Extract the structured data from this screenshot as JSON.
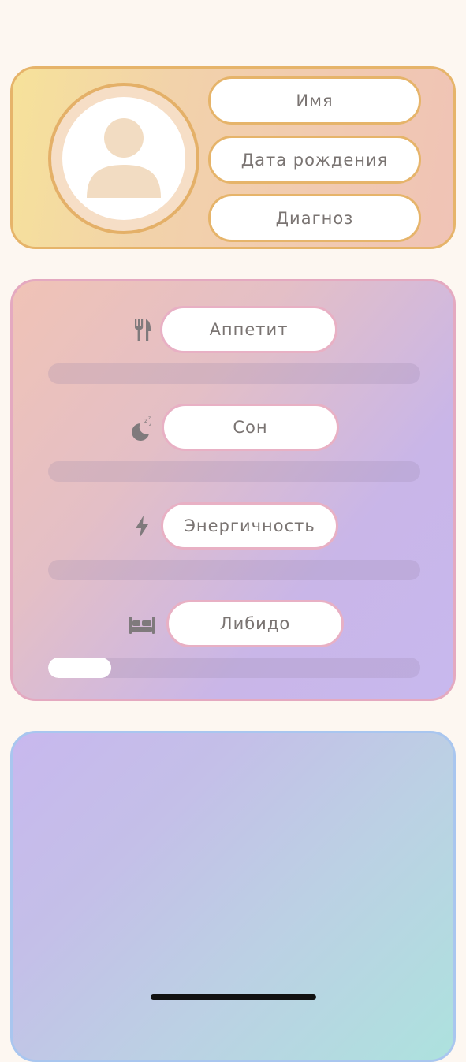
{
  "profile": {
    "name_label": "Имя",
    "birthdate_label": "Дата рождения",
    "diagnosis_label": "Диагноз"
  },
  "metrics": [
    {
      "label": "Аппетит",
      "icon": "fork-knife-icon",
      "level": 0
    },
    {
      "label": "Сон",
      "icon": "moon-sleep-icon",
      "level": 0
    },
    {
      "label": "Энергичность",
      "icon": "lightning-icon",
      "level": 0
    },
    {
      "label": "Либидо",
      "icon": "bed-icon",
      "level": 0.17
    }
  ],
  "colors": {
    "background": "#fdf7f1",
    "profile_border": "#e6b46a",
    "metrics_border": "#e4a9c0",
    "bottom_border": "#a9c6ef",
    "text": "#7a7472",
    "icon": "#7f7a7c"
  }
}
